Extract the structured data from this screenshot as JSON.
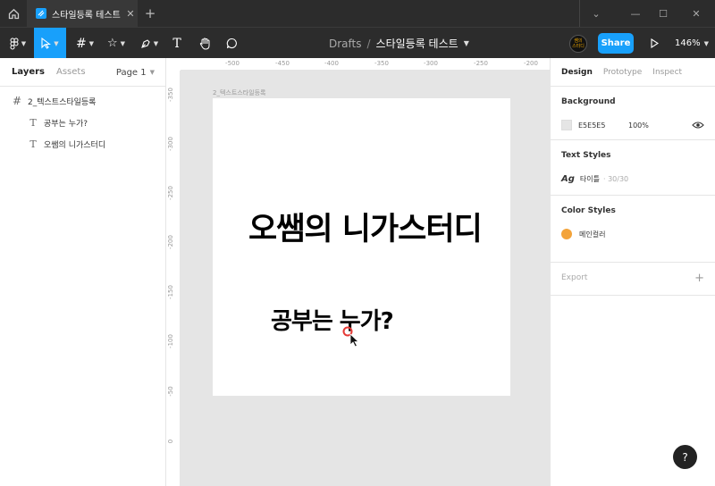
{
  "titlebar": {
    "tab_title": "스타일등록 테스트",
    "tab_close": "✕",
    "new_tab": "+",
    "minimize": "—",
    "maximize": "☐",
    "close": "✕",
    "dropdown": "⌄"
  },
  "toolbar": {
    "breadcrumb_drafts": "Drafts",
    "breadcrumb_sep": "/",
    "file_name": "스타일등록 테스트",
    "avatar_text_1": "쌤의",
    "avatar_text_2": "스터디",
    "share_label": "Share",
    "zoom": "146%"
  },
  "left_panel": {
    "tab_layers": "Layers",
    "tab_assets": "Assets",
    "page": "Page 1",
    "layers": [
      {
        "name": "2_텍스트스타일등록",
        "icon": "frame-icon"
      },
      {
        "name": "공부는 누가?",
        "icon": "text-icon"
      },
      {
        "name": "오쌤의 니가스터디",
        "icon": "text-icon"
      }
    ]
  },
  "ruler_x": [
    "-500",
    "-450",
    "-400",
    "-350",
    "-300",
    "-250",
    "-200"
  ],
  "ruler_y": [
    "-350",
    "-300",
    "-250",
    "-200",
    "-150",
    "-100",
    "-50",
    "0"
  ],
  "canvas": {
    "frame_label": "2_텍스트스타일등록",
    "text_big": "오쌤의 니가스터디",
    "text_small": "공부는 누가?"
  },
  "right_panel": {
    "tab_design": "Design",
    "tab_prototype": "Prototype",
    "tab_inspect": "Inspect",
    "background_title": "Background",
    "background_hex": "E5E5E5",
    "background_opacity": "100%",
    "text_styles_title": "Text Styles",
    "text_style_icon": "Ag",
    "text_style_name": "타이틀",
    "text_style_meta": "· 30/30",
    "color_styles_title": "Color Styles",
    "color_style_name": "메인컬러",
    "export_title": "Export",
    "export_add": "+"
  },
  "colors": {
    "accent": "#18a0fb",
    "canvas_bg": "#e5e5e5",
    "main_color": "#f3a33a",
    "toolbar_bg": "#2c2c2c"
  },
  "help": "?"
}
